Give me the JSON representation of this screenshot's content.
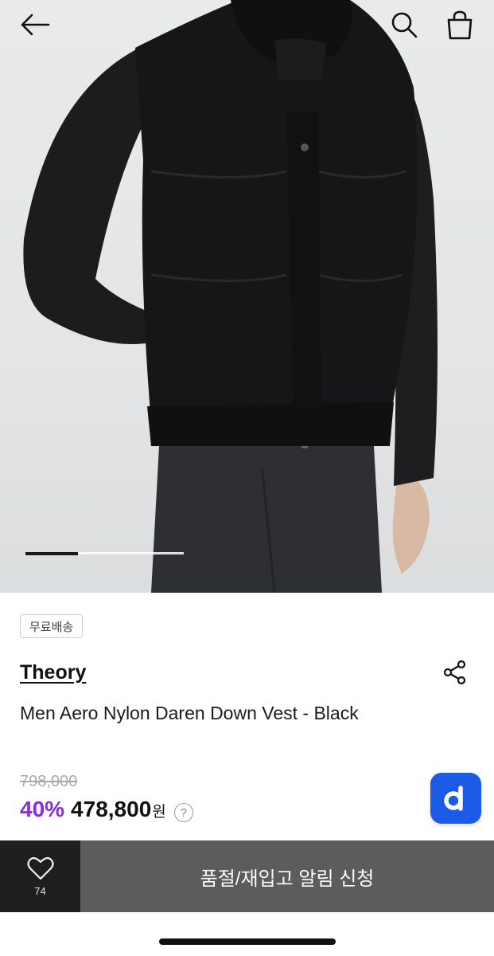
{
  "hero": {
    "image_label": "product-photo-black-down-vest",
    "pager": {
      "current": 1,
      "total": 3
    }
  },
  "header": {
    "back_icon": "arrow-left-icon",
    "search_icon": "search-icon",
    "bag_icon": "shopping-bag-icon"
  },
  "product": {
    "badge": "무료배송",
    "brand": "Theory",
    "title": "Men Aero Nylon Daren Down Vest - Black",
    "original_price": "798,000",
    "discount": "40%",
    "price": "478,800",
    "currency": "원",
    "help_symbol": "?"
  },
  "floating_button": {
    "label": "d",
    "color": "#1b5be8"
  },
  "bottom_bar": {
    "like_count": "74",
    "cta_label": "품절/재입고 알림 신청"
  },
  "colors": {
    "accent_discount": "#8a2be2",
    "cta_bg": "#5c5c5c",
    "like_bg": "#1f1f1f"
  }
}
